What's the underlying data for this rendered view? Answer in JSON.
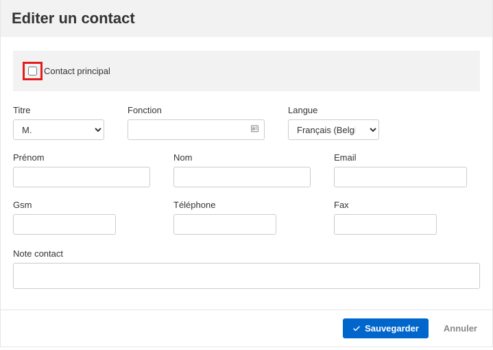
{
  "header": {
    "title": "Editer un contact"
  },
  "principal": {
    "label": "Contact principal"
  },
  "fields": {
    "titre": {
      "label": "Titre",
      "value": "M."
    },
    "fonction": {
      "label": "Fonction",
      "value": ""
    },
    "langue": {
      "label": "Langue",
      "value": "Français (Belgique)"
    },
    "prenom": {
      "label": "Prénom",
      "value": ""
    },
    "nom": {
      "label": "Nom",
      "value": ""
    },
    "email": {
      "label": "Email",
      "value": ""
    },
    "gsm": {
      "label": "Gsm",
      "value": ""
    },
    "telephone": {
      "label": "Téléphone",
      "value": ""
    },
    "fax": {
      "label": "Fax",
      "value": ""
    },
    "note": {
      "label": "Note contact",
      "value": ""
    }
  },
  "footer": {
    "save": "Sauvegarder",
    "cancel": "Annuler"
  }
}
